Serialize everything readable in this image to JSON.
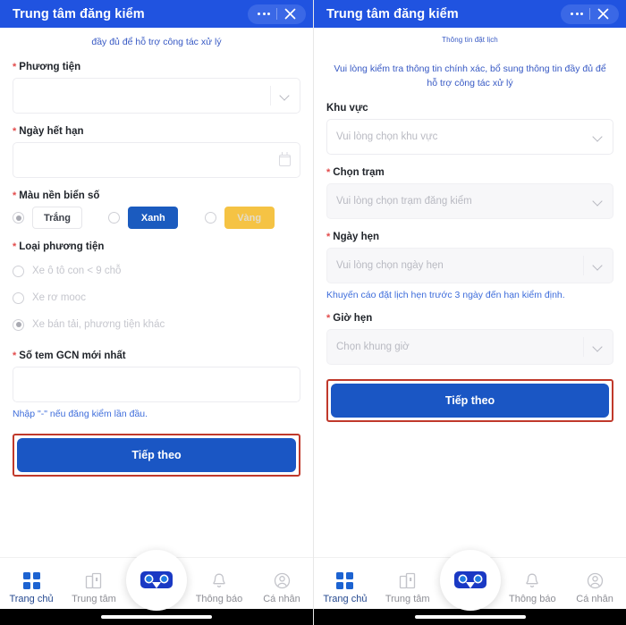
{
  "accent": {
    "header_blue": "#2053e0",
    "primary_blue": "#1a56c4",
    "link_blue": "#3759c4",
    "annotation_red": "#c0392b",
    "amber": "#f5c344"
  },
  "left_screen": {
    "header": {
      "title": "Trung tâm đăng kiểm",
      "more_icon": "more-horizontal-icon",
      "close_icon": "close-icon"
    },
    "intro_partial": "đầy đủ để hỗ trợ công tác xử lý",
    "fields": {
      "vehicle": {
        "label": "Phương tiện",
        "required": true,
        "value": "",
        "placeholder": ""
      },
      "expiry": {
        "label": "Ngày hết hạn",
        "required": true,
        "value": "",
        "placeholder": ""
      },
      "plate_color": {
        "label": "Màu nền biển số",
        "required": true,
        "options": [
          {
            "label": "Trắng",
            "selected": true,
            "style": "white"
          },
          {
            "label": "Xanh",
            "selected": false,
            "style": "blue"
          },
          {
            "label": "Vàng",
            "selected": false,
            "style": "amber"
          }
        ]
      },
      "vehicle_type": {
        "label": "Loại phương tiện",
        "required": true,
        "options": [
          {
            "label": "Xe ô tô con < 9 chỗ",
            "selected": false
          },
          {
            "label": "Xe rơ mooc",
            "selected": false
          },
          {
            "label": "Xe bán tải, phương tiện khác",
            "selected": true
          }
        ]
      },
      "gcn": {
        "label": "Số tem GCN mới nhất",
        "required": true,
        "value": "",
        "hint": "Nhập \"-\" nếu đăng kiểm lần đầu."
      }
    },
    "cta_label": "Tiếp theo",
    "nav": [
      {
        "label": "Trang chủ",
        "icon": "grid-home-icon",
        "active": true
      },
      {
        "label": "Trung tâm",
        "icon": "building-icon",
        "active": false
      },
      {
        "label": "",
        "icon": "vr-goggles-fab-icon",
        "active": false
      },
      {
        "label": "Thông báo",
        "icon": "bell-icon",
        "active": false
      },
      {
        "label": "Cá nhân",
        "icon": "person-icon",
        "active": false
      }
    ]
  },
  "right_screen": {
    "header": {
      "title": "Trung tâm đăng kiểm",
      "more_icon": "more-horizontal-icon",
      "close_icon": "close-icon"
    },
    "section_title": "Thông tin đặt lịch",
    "intro_note": "Vui lòng kiểm tra thông tin chính xác, bổ sung thông tin đầy đủ để hỗ trợ công tác xử lý",
    "fields": {
      "area": {
        "label": "Khu vực",
        "required": false,
        "value": "",
        "placeholder": "Vui lòng chọn khu vực"
      },
      "station": {
        "label": "Chọn trạm",
        "required": true,
        "value": "",
        "placeholder": "Vui lòng chọn trạm đăng kiểm"
      },
      "date": {
        "label": "Ngày hẹn",
        "required": true,
        "value": "",
        "placeholder": "Vui lòng chọn ngày hẹn",
        "hint": "Khuyến cáo đặt lịch hẹn trước 3 ngày đến hạn kiểm định."
      },
      "time": {
        "label": "Giờ hẹn",
        "required": true,
        "value": "",
        "placeholder": "Chọn khung giờ"
      }
    },
    "cta_label": "Tiếp theo",
    "nav": [
      {
        "label": "Trang chủ",
        "icon": "grid-home-icon",
        "active": true
      },
      {
        "label": "Trung tâm",
        "icon": "building-icon",
        "active": false
      },
      {
        "label": "",
        "icon": "vr-goggles-fab-icon",
        "active": false
      },
      {
        "label": "Thông báo",
        "icon": "bell-icon",
        "active": false
      },
      {
        "label": "Cá nhân",
        "icon": "person-icon",
        "active": false
      }
    ]
  }
}
